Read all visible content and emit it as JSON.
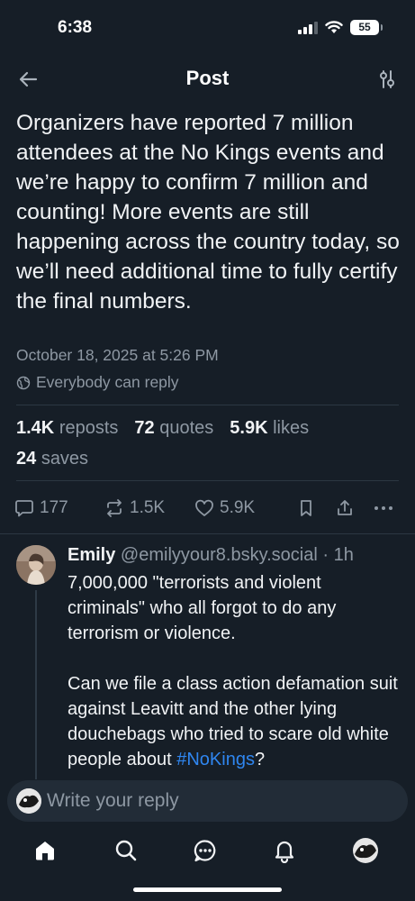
{
  "status_bar": {
    "time": "6:38",
    "battery": "55"
  },
  "header": {
    "title": "Post"
  },
  "post": {
    "text": "Organizers have reported 7 million attendees at the No Kings events and we’re happy to confirm 7 million and counting! More events are still happening across the country today, so we’ll need additional time to fully certify the final numbers.",
    "date": "October 18, 2025 at 5:26 PM",
    "reply_setting": "Everybody can reply",
    "stats": {
      "reposts_count": "1.4K",
      "reposts_label": "reposts",
      "quotes_count": "72",
      "quotes_label": "quotes",
      "likes_count": "5.9K",
      "likes_label": "likes",
      "saves_count": "24",
      "saves_label": "saves"
    },
    "actions": {
      "replies": "177",
      "reposts": "1.5K",
      "likes": "5.9K"
    }
  },
  "reply": {
    "name": "Emily",
    "handle": "@emilyyour8.bsky.social",
    "time": "· 1h",
    "paragraph1": "7,000,000 \"terrorists and violent criminals\" who all forgot to do any terrorism or violence.",
    "paragraph2_text": "Can we file a class action defamation suit against Leavitt and the other lying douchebags who tried to scare old white people about ",
    "hashtag": "#NoKings",
    "paragraph2_end": "?"
  },
  "composer": {
    "placeholder": "Write your reply"
  },
  "tabs": [
    "home-icon",
    "search-icon",
    "chat-icon",
    "bell-icon",
    "profile-avatar"
  ],
  "colors": {
    "background": "#161e27",
    "muted": "#8e98a3",
    "link": "#2f86f0"
  }
}
